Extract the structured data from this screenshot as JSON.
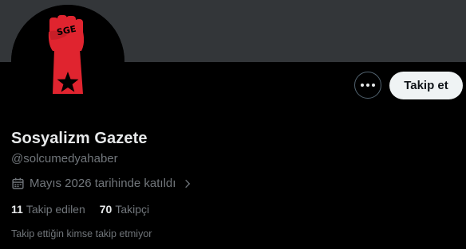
{
  "profile": {
    "display_name": "Sosyalizm Gazete",
    "handle": "@solcumedyahaber",
    "joined": "Mayıs 2026 tarihinde katıldı",
    "avatar_text": "SGE"
  },
  "actions": {
    "follow_label": "Takip et",
    "more_icon": "more-dots-icon"
  },
  "stats": {
    "following_count": "11",
    "following_label": "Takip edilen",
    "followers_count": "70",
    "followers_label": "Takipçi"
  },
  "note": "Takip ettiğin kimse takip etmiyor",
  "colors": {
    "banner": "#333639",
    "background": "#000000",
    "text_primary": "#e7e9ea",
    "text_secondary": "#71767b",
    "follow_bg": "#eff3f4",
    "avatar_red": "#e0242f"
  }
}
